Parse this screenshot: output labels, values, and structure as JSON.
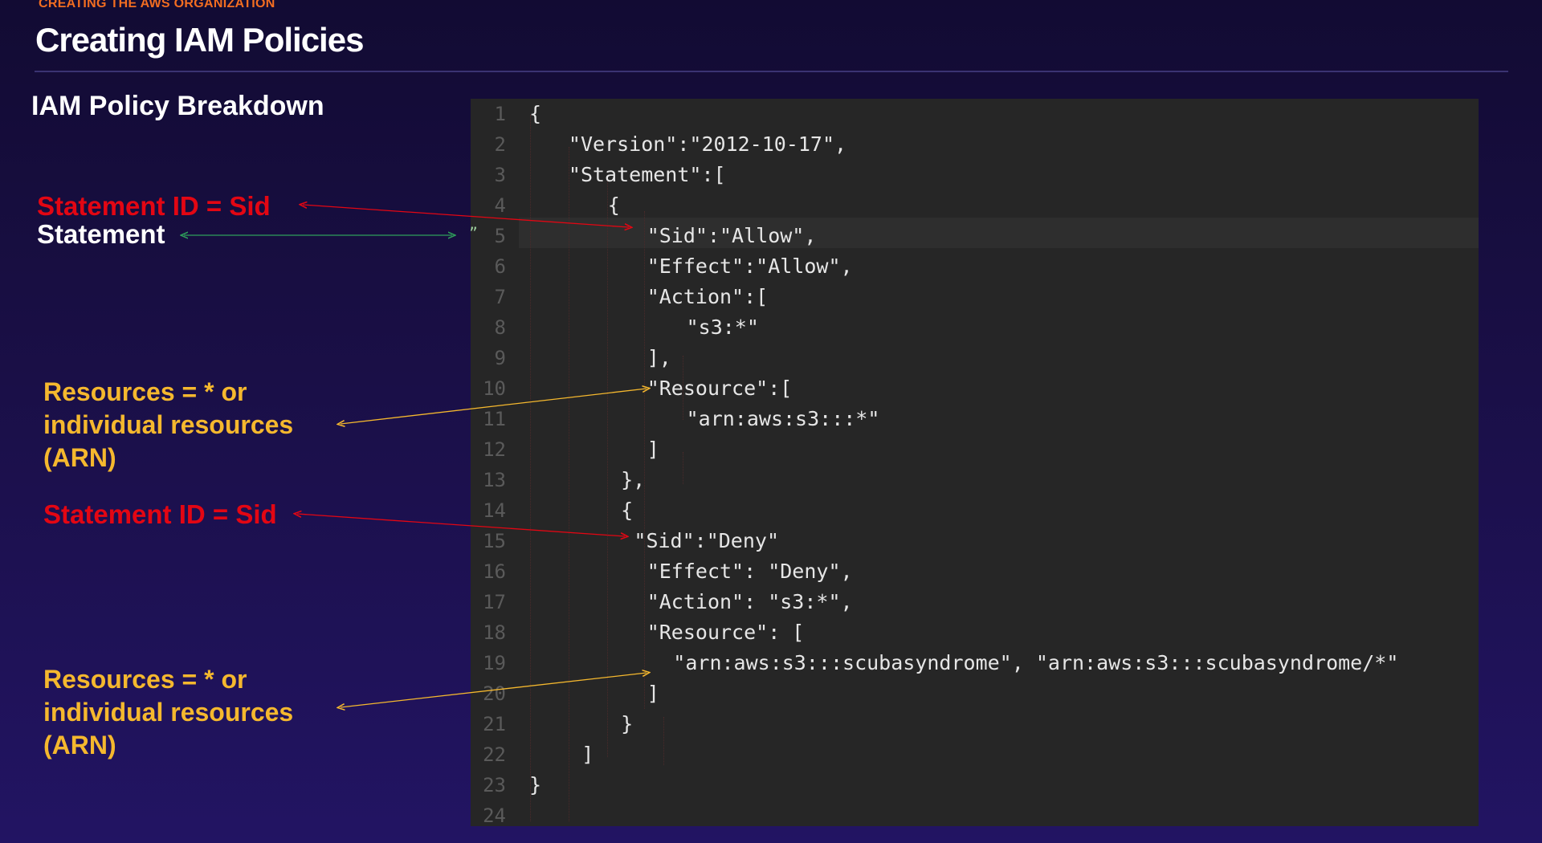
{
  "header": {
    "kicker": "CREATING THE AWS ORGANIZATION",
    "title": "Creating IAM Policies",
    "section_title": "IAM Policy Breakdown"
  },
  "annotations": {
    "sid_1": "Statement ID = Sid",
    "statement": "Statement",
    "resources_1": [
      "Resources = * or",
      "individual resources",
      "(ARN)"
    ],
    "sid_2": "Statement ID = Sid",
    "resources_2": [
      "Resources = * or",
      "individual resources",
      "(ARN)"
    ]
  },
  "editor": {
    "current_line": 5,
    "lines": [
      {
        "n": "1",
        "indent": 0,
        "text": "{"
      },
      {
        "n": "2",
        "indent": 3,
        "text": "\"Version\":\"2012-10-17\","
      },
      {
        "n": "3",
        "indent": 3,
        "text": "\"Statement\":["
      },
      {
        "n": "4",
        "indent": 6,
        "text": "{"
      },
      {
        "n": "5",
        "indent": 9,
        "text": "\"Sid\":\"Allow\","
      },
      {
        "n": "6",
        "indent": 9,
        "text": "\"Effect\":\"Allow\","
      },
      {
        "n": "7",
        "indent": 9,
        "text": "\"Action\":["
      },
      {
        "n": "8",
        "indent": 12,
        "text": "\"s3:*\""
      },
      {
        "n": "9",
        "indent": 9,
        "text": "],"
      },
      {
        "n": "10",
        "indent": 9,
        "text": "\"Resource\":["
      },
      {
        "n": "11",
        "indent": 12,
        "text": "\"arn:aws:s3:::*\""
      },
      {
        "n": "12",
        "indent": 9,
        "text": "]"
      },
      {
        "n": "13",
        "indent": 7,
        "text": "},"
      },
      {
        "n": "14",
        "indent": 7,
        "text": "{"
      },
      {
        "n": "15",
        "indent": 8,
        "text": "\"Sid\":\"Deny\""
      },
      {
        "n": "16",
        "indent": 9,
        "text": "\"Effect\": \"Deny\","
      },
      {
        "n": "17",
        "indent": 9,
        "text": "\"Action\": \"s3:*\","
      },
      {
        "n": "18",
        "indent": 9,
        "text": "\"Resource\": ["
      },
      {
        "n": "19",
        "indent": 11,
        "text": "\"arn:aws:s3:::scubasyndrome\", \"arn:aws:s3:::scubasyndrome/*\""
      },
      {
        "n": "20",
        "indent": 9,
        "text": "]"
      },
      {
        "n": "21",
        "indent": 7,
        "text": "}"
      },
      {
        "n": "22",
        "indent": 4,
        "text": "]"
      },
      {
        "n": "23",
        "indent": 0,
        "text": "}"
      },
      {
        "n": "24",
        "indent": 0,
        "text": ""
      }
    ]
  },
  "colors": {
    "red": "#e30613",
    "yellow": "#f5b82e",
    "green": "#2e9e5a",
    "white": "#ffffff",
    "editor_bg": "#262626"
  }
}
